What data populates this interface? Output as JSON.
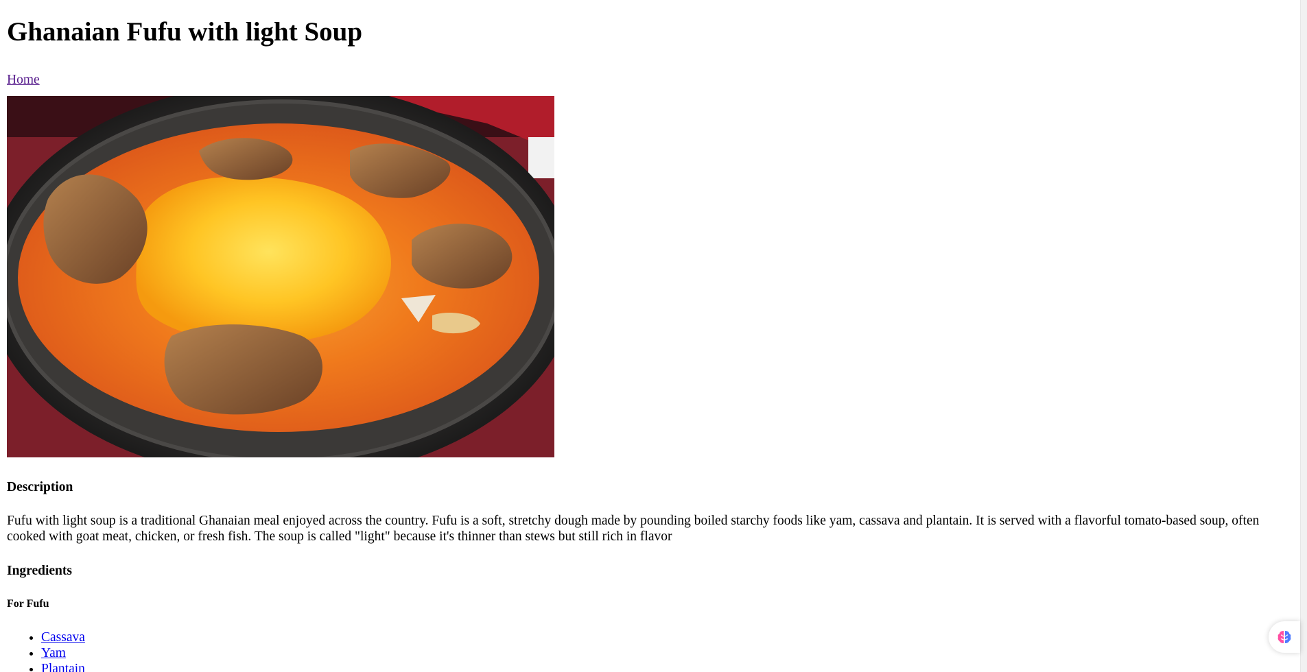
{
  "page": {
    "title": "Ghanaian Fufu with light Soup",
    "nav": {
      "home_label": "Home"
    },
    "image": {
      "alt": "Fufu with light soup"
    },
    "description": {
      "heading": "Description",
      "text": "Fufu with light soup is a traditional Ghanaian meal enjoyed across the country. Fufu is a soft, stretchy dough made by pounding boiled starchy foods like yam, cassava and plantain. It is served with a flavorful tomato-based soup, often cooked with goat meat, chicken, or fresh fish. The soup is called \"light\" because it's thinner than stews but still rich in flavor"
    },
    "ingredients": {
      "heading": "Ingredients",
      "fufu_heading": "For Fufu",
      "fufu_items": [
        "Cassava",
        "Yam",
        "Plantain"
      ]
    }
  },
  "extension": {
    "icon": "brain-icon",
    "colors": {
      "left": "#ff4fa3",
      "right": "#4f7bff"
    }
  }
}
